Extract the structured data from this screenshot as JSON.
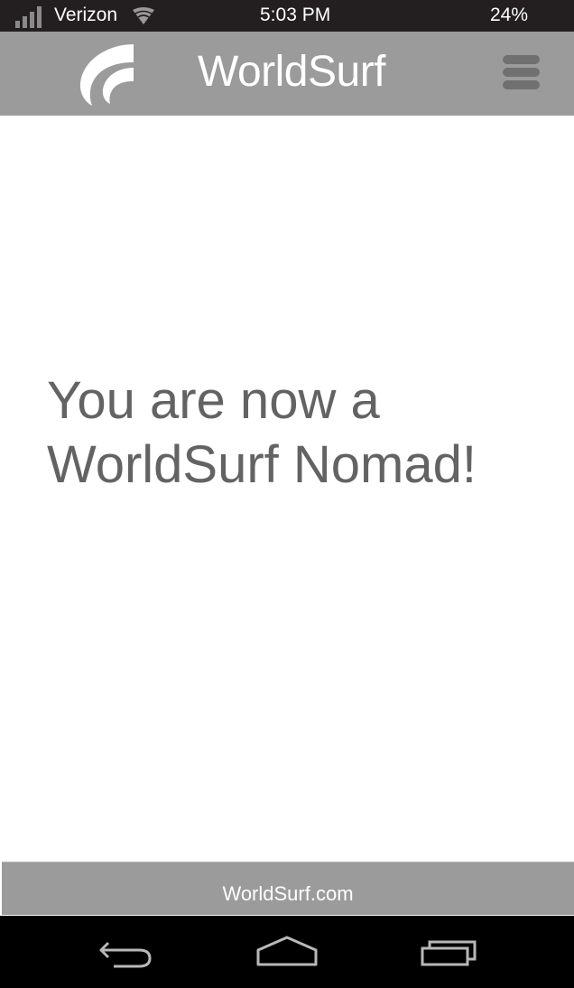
{
  "status_bar": {
    "carrier": "Verizon",
    "time": "5:03 PM",
    "battery": "24%",
    "icons": [
      "signal-icon",
      "wifi-icon"
    ]
  },
  "header": {
    "title": "WorldSurf",
    "logo": "worldsurf-logo",
    "menu_icon": "menu-icon"
  },
  "main": {
    "message_line1": "You are now a",
    "message_line2": "WorldSurf Nomad!"
  },
  "footer": {
    "link": "WorldSurf.com"
  },
  "nav_bar": {
    "icons": [
      "back-icon",
      "home-icon",
      "recent-apps-icon"
    ]
  },
  "colors": {
    "status_bar": "#231f20",
    "header": "#9b9b9b",
    "message_text": "#636363",
    "menu_bars": "#707070",
    "nav_bar": "#000000"
  }
}
